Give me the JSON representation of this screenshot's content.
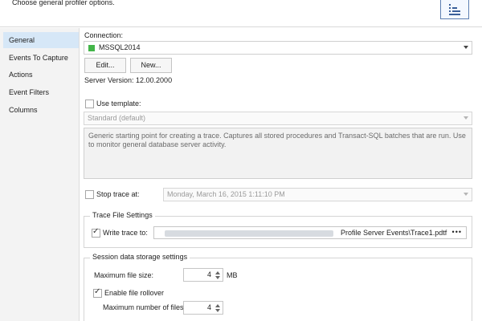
{
  "header": {
    "subtitle": "Choose general profiler options."
  },
  "sidebar": {
    "items": [
      {
        "label": "General",
        "active": true
      },
      {
        "label": "Events To Capture"
      },
      {
        "label": "Actions"
      },
      {
        "label": "Event Filters"
      },
      {
        "label": "Columns"
      }
    ]
  },
  "connection": {
    "label": "Connection:",
    "value": "MSSQL2014",
    "status_color": "#43b549",
    "edit_label": "Edit...",
    "new_label": "New...",
    "server_version": "Server Version: 12.00.2000"
  },
  "template": {
    "checkbox_label": "Use template:",
    "checked": false,
    "value": "Standard (default)",
    "description": "Generic starting point for creating a trace. Captures all stored procedures and Transact-SQL batches that are run. Use to monitor general database server activity."
  },
  "stop_trace": {
    "checkbox_label": "Stop trace at:",
    "checked": false,
    "value": "Monday, March 16, 2015 1:11:10 PM"
  },
  "trace_file": {
    "group_title": "Trace File Settings",
    "checkbox_label": "Write trace to:",
    "checked": true,
    "path_visible": "Profile Server Events\\Trace1.pdtf",
    "browse_label": "•••"
  },
  "session": {
    "group_title": "Session data storage settings",
    "max_file_size_label": "Maximum file size:",
    "max_file_size_value": "4",
    "max_file_size_unit": "MB",
    "rollover_label": "Enable file rollover",
    "rollover_checked": true,
    "max_files_label": "Maximum number of files:",
    "max_files_value": "4"
  },
  "colors": {
    "accent_selection": "#d6e7f7",
    "status_green": "#43b549"
  }
}
